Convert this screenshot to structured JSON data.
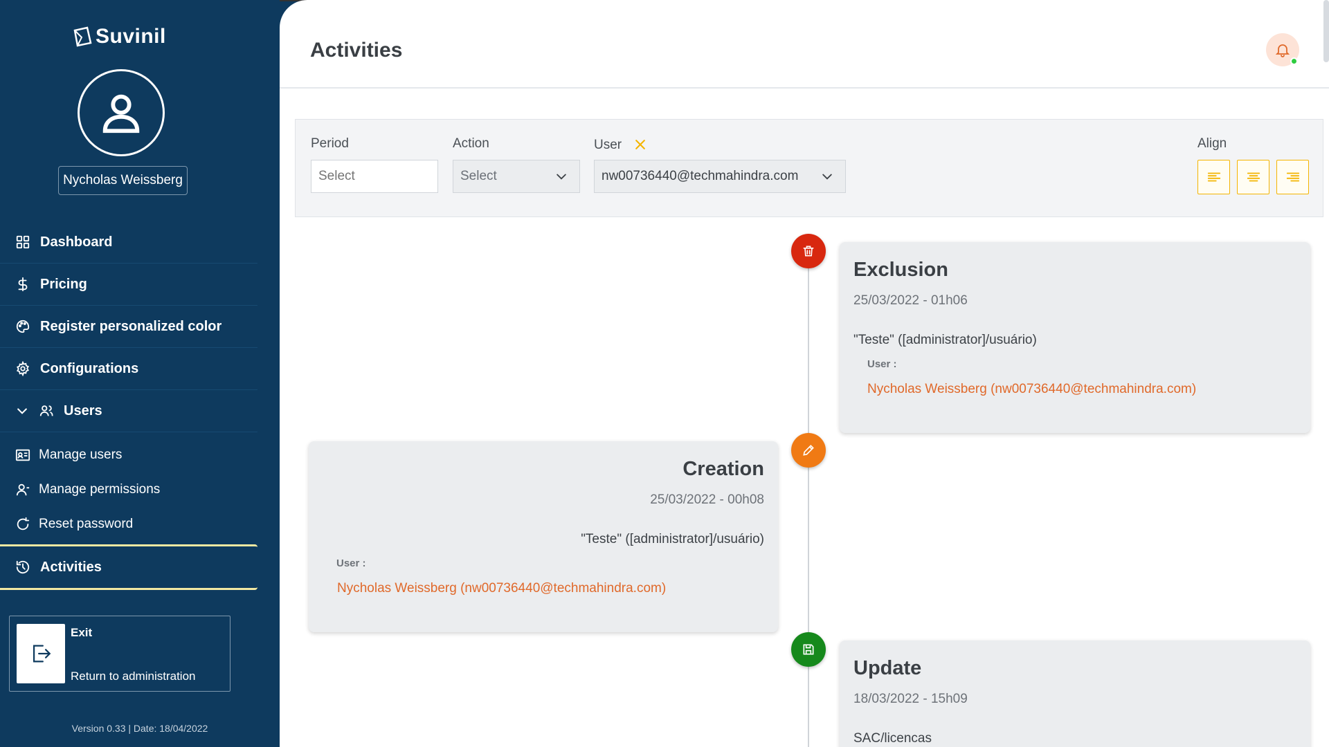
{
  "brand": {
    "name": "Suvinil"
  },
  "user": {
    "name": "Nycholas Weissberg"
  },
  "sidebar": {
    "items": [
      {
        "label": "Dashboard",
        "icon": "grid-icon"
      },
      {
        "label": "Pricing",
        "icon": "dollar-icon"
      },
      {
        "label": "Register personalized color",
        "icon": "palette-icon"
      },
      {
        "label": "Configurations",
        "icon": "gear-icon"
      },
      {
        "label": "Users",
        "icon": "users-icon"
      }
    ],
    "sub_items": [
      {
        "label": "Manage users",
        "icon": "id-card-icon"
      },
      {
        "label": "Manage permissions",
        "icon": "user-icon"
      },
      {
        "label": "Reset password",
        "icon": "refresh-icon"
      }
    ],
    "active": {
      "label": "Activities",
      "icon": "history-icon"
    },
    "exit": {
      "title": "Exit",
      "subtitle": "Return to administration"
    },
    "version": "Version 0.33 | Date: 18/04/2022"
  },
  "header": {
    "title": "Activities"
  },
  "filters": {
    "period": {
      "label": "Period",
      "placeholder": "Select"
    },
    "action": {
      "label": "Action",
      "value": "Select"
    },
    "user": {
      "label": "User",
      "value": "nw00736440@techmahindra.com"
    },
    "align": {
      "label": "Align"
    }
  },
  "timeline": [
    {
      "title": "Exclusion",
      "date": "25/03/2022 - 01h06",
      "description": "\"Teste\" ([administrator]/usuário)",
      "user_label": "User :",
      "user": "Nycholas Weissberg (nw00736440@techmahindra.com)",
      "icon": "trash-icon",
      "color": "#d8280f"
    },
    {
      "title": "Creation",
      "date": "25/03/2022 - 00h08",
      "description": "\"Teste\" ([administrator]/usuário)",
      "user_label": "User :",
      "user": "Nycholas Weissberg (nw00736440@techmahindra.com)",
      "icon": "pencil-icon",
      "color": "#f07a14"
    },
    {
      "title": "Update",
      "date": "18/03/2022 - 15h09",
      "description": "SAC/licencas",
      "icon": "save-icon",
      "color": "#16891c"
    }
  ],
  "colors": {
    "sidebar_bg": "#0e3a5e",
    "accent": "#e0692a",
    "align_border": "#f4b400"
  }
}
